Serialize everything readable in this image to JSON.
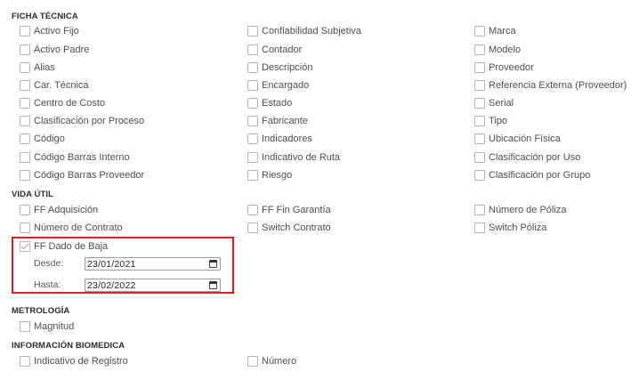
{
  "sections": {
    "ficha": "FICHA TÉCNICA",
    "vida": "VIDA ÚTIL",
    "metrologia": "METROLOGÍA",
    "biomedica": "INFORMACIÓN BIOMEDICA"
  },
  "ficha": {
    "col1": [
      "Activo Fijo",
      "Activo Padre",
      "Alias",
      "Car. Técnica",
      "Centro de Costo",
      "Clasificación por Proceso",
      "Código",
      "Código Barras Interno",
      "Código Barras Proveedor"
    ],
    "col2": [
      "Confiabilidad Subjetiva",
      "Contador",
      "Descripción",
      "Encargado",
      "Estado",
      "Fabricante",
      "Indicadores",
      "Indicativo de Ruta",
      "Riesgo"
    ],
    "col3": [
      "Marca",
      "Modelo",
      "Proveedor",
      "Referencia Externa (Proveedor)",
      "Serial",
      "Tipo",
      "Ubicación Física",
      "Clasificación por Uso",
      "Clasificación por Grupo"
    ]
  },
  "vida": {
    "col1": [
      "FF Adquisición",
      "Número de Contrato"
    ],
    "col2": [
      "FF Fin Garantía",
      "Switch Contrato"
    ],
    "col3": [
      "Número de Póliza",
      "Switch Póliza"
    ],
    "baja": {
      "label": "FF Dado de Baja",
      "checked": true,
      "desde_label": "Desde:",
      "desde_value": "23/01/2021",
      "hasta_label": "Hasta:",
      "hasta_value": "23/02/2022"
    }
  },
  "metrologia": {
    "items": [
      "Magnitud"
    ]
  },
  "biomedica": {
    "items": [
      "Indicativo de Registro",
      "Número"
    ]
  },
  "colors": {
    "highlight": "#e02020",
    "checkbox_border": "#b5b5b5"
  }
}
